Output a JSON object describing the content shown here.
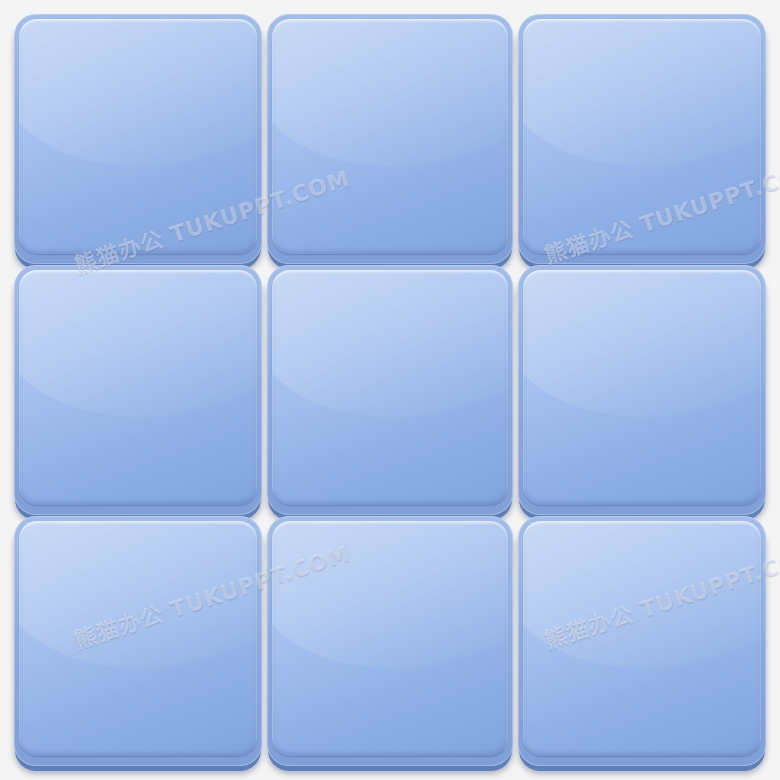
{
  "tiles": {
    "rows": 3,
    "columns": 3,
    "color": "#9ab6e6",
    "edge_color": "#5f7fb8"
  },
  "watermark": {
    "text": "熊猫办公 TUKUPPT.COM"
  }
}
